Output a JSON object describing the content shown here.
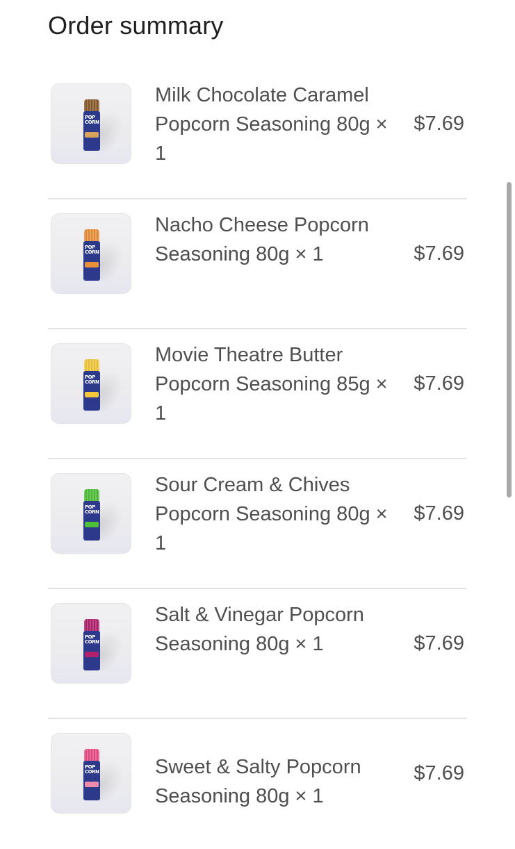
{
  "header": {
    "title": "Order summary"
  },
  "items": [
    {
      "name": "Milk Chocolate Caramel Popcorn Seasoning 80g × 1",
      "price": "$7.69",
      "cap_color": "#8a5a2e",
      "band_color": "#d9a35b",
      "logo_text": "POP CORN"
    },
    {
      "name": "Nacho Cheese Popcorn Seasoning 80g × 1",
      "price": "$7.69",
      "cap_color": "#e8903a",
      "band_color": "#e8903a",
      "logo_text": "POP CORN"
    },
    {
      "name": "Movie Theatre Butter Popcorn Seasoning 85g × 1",
      "price": "$7.69",
      "cap_color": "#f2c73c",
      "band_color": "#f2c73c",
      "logo_text": "POP CORN"
    },
    {
      "name": "Sour Cream & Chives Popcorn Seasoning 80g × 1",
      "price": "$7.69",
      "cap_color": "#4fbf3a",
      "band_color": "#4fbf3a",
      "logo_text": "POP CORN"
    },
    {
      "name": "Salt & Vinegar Popcorn Seasoning 80g × 1",
      "price": "$7.69",
      "cap_color": "#b0226e",
      "band_color": "#b0226e",
      "logo_text": "POP CORN"
    },
    {
      "name": "Sweet & Salty Popcorn Seasoning 80g × 1",
      "price": "$7.69",
      "cap_color": "#e94d86",
      "band_color": "#f08bb0",
      "logo_text": "POP CORN"
    }
  ]
}
